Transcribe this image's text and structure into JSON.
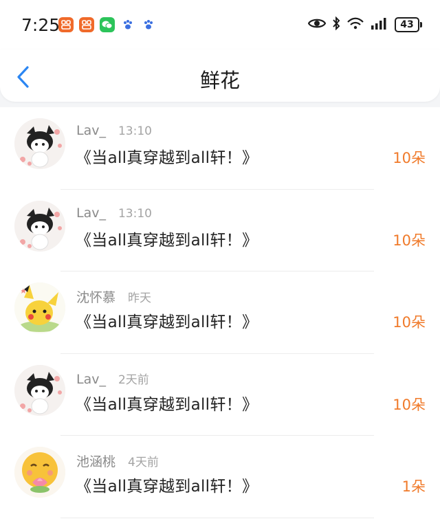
{
  "status_bar": {
    "time": "7:25",
    "battery": "43"
  },
  "header": {
    "title": "鲜花"
  },
  "items": [
    {
      "user": "Lav_",
      "time": "13:10",
      "title": "《当all真穿越到all轩！》",
      "count": "10朵"
    },
    {
      "user": "Lav_",
      "time": "13:10",
      "title": "《当all真穿越到all轩！》",
      "count": "10朵"
    },
    {
      "user": "沈怀慕",
      "time": "昨天",
      "title": "《当all真穿越到all轩！》",
      "count": "10朵"
    },
    {
      "user": "Lav_",
      "time": "2天前",
      "title": "《当all真穿越到all轩！》",
      "count": "10朵"
    },
    {
      "user": "池涵桃",
      "time": "4天前",
      "title": "《当all真穿越到all轩！》",
      "count": "1朵"
    }
  ],
  "colors": {
    "accent": "#f07a2a",
    "back_arrow": "#2b86f2"
  },
  "icons": {
    "status_notifications": [
      "app-notification-icon",
      "app-notification-icon",
      "wechat-icon",
      "paw-icon",
      "paw-icon"
    ],
    "status_system": [
      "eye-icon",
      "bluetooth-icon",
      "wifi-icon",
      "signal-icon",
      "battery-icon"
    ],
    "avatars": [
      "kuromi-avatar",
      "kuromi-avatar",
      "pikachu-avatar",
      "kuromi-avatar",
      "emoji-avatar"
    ]
  }
}
